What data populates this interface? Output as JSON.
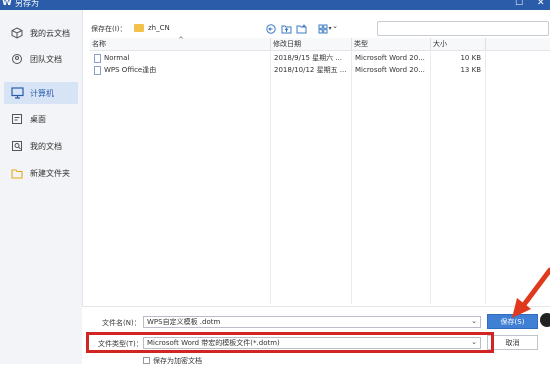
{
  "window": {
    "title": "另存为",
    "app_icon": "W",
    "close": "✕",
    "maximize": "☐"
  },
  "sidebar": {
    "items": [
      {
        "label": "我的云文档",
        "icon": "cloud-box-icon"
      },
      {
        "label": "团队文档",
        "icon": "team-icon"
      },
      {
        "label": "计算机",
        "icon": "computer-icon",
        "active": true
      },
      {
        "label": "桌面",
        "icon": "desktop-icon"
      },
      {
        "label": "我的文档",
        "icon": "documents-icon"
      },
      {
        "label": "新建文件夹",
        "icon": "folder-icon"
      }
    ]
  },
  "toolbar": {
    "save_in_label": "保存在(I)：",
    "folder_name": "zh_CN",
    "dropdown_glyph": "⌄",
    "back_glyph": "⊖",
    "up_glyph": "▭",
    "newfolder_glyph": "⊞",
    "view_glyph": "▦",
    "view_dd": "▾",
    "search_placeholder": ""
  },
  "filelist": {
    "columns": [
      "名称",
      "修改日期",
      "类型",
      "大小"
    ],
    "rows": [
      {
        "name": "Normal",
        "modified": "2018/9/15 星期六 ...",
        "type": "Microsoft Word 20...",
        "size": "10 KB"
      },
      {
        "name": "WPS Office逢由",
        "modified": "2018/10/12 星期五 ...",
        "type": "Microsoft Word 20...",
        "size": "13 KB"
      }
    ]
  },
  "bottom": {
    "filename_label": "文件名(N)：",
    "filename_value": "WPS自定义模板 .dotm",
    "filetype_label": "文件类型(T)：",
    "filetype_value": "Microsoft Word 带宏的模板文件(*.dotm)",
    "save_button": "保存(S)",
    "cancel_button": "取消",
    "encrypt_label": "保存为加密文档",
    "dd_glyph": "⌄"
  },
  "colors": {
    "accent": "#2a5caa",
    "primary_button": "#3f7fd4",
    "highlight": "#d32424",
    "annotation_arrow": "#e03a1e"
  }
}
